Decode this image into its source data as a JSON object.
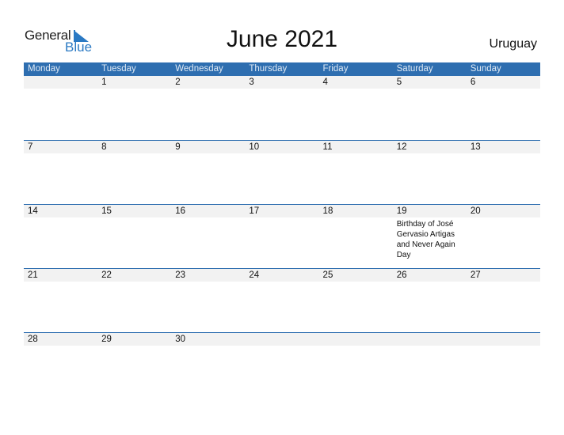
{
  "brand": {
    "line1": "General",
    "line2": "Blue",
    "color": "#2a79c3"
  },
  "title": "June 2021",
  "country": "Uruguay",
  "colors": {
    "header_bg": "#2e6eb0",
    "strip_bg": "#f2f2f2"
  },
  "weekdays": [
    "Monday",
    "Tuesday",
    "Wednesday",
    "Thursday",
    "Friday",
    "Saturday",
    "Sunday"
  ],
  "weeks": [
    {
      "days": [
        "",
        "1",
        "2",
        "3",
        "4",
        "5",
        "6"
      ],
      "events": [
        "",
        "",
        "",
        "",
        "",
        "",
        ""
      ]
    },
    {
      "days": [
        "7",
        "8",
        "9",
        "10",
        "11",
        "12",
        "13"
      ],
      "events": [
        "",
        "",
        "",
        "",
        "",
        "",
        ""
      ]
    },
    {
      "days": [
        "14",
        "15",
        "16",
        "17",
        "18",
        "19",
        "20"
      ],
      "events": [
        "",
        "",
        "",
        "",
        "",
        "Birthday of José Gervasio Artigas and Never Again Day",
        ""
      ]
    },
    {
      "days": [
        "21",
        "22",
        "23",
        "24",
        "25",
        "26",
        "27"
      ],
      "events": [
        "",
        "",
        "",
        "",
        "",
        "",
        ""
      ]
    },
    {
      "days": [
        "28",
        "29",
        "30",
        "",
        "",
        "",
        ""
      ],
      "events": [
        "",
        "",
        "",
        "",
        "",
        "",
        ""
      ]
    }
  ]
}
